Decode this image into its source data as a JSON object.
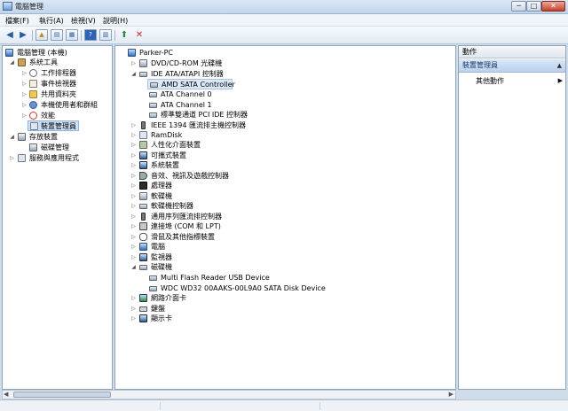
{
  "window": {
    "title": "電腦管理"
  },
  "window_buttons": {
    "minimize": "─",
    "maximize": "□",
    "close": "✕"
  },
  "menu": [
    "檔案(F)",
    "執行(A)",
    "檢視(V)",
    "說明(H)"
  ],
  "toolbar_icons": [
    "back-arrow-icon",
    "forward-arrow-icon",
    "up-folder-icon",
    "show-tree-icon",
    "properties-icon",
    "help-icon",
    "show-action-pane-icon",
    "update-driver-icon",
    "uninstall-icon"
  ],
  "left_tree": {
    "root": "電腦管理 (本機)",
    "items": [
      {
        "label": "系統工具",
        "level": 1,
        "expander": "◢",
        "icon": "tools-icon"
      },
      {
        "label": "工作排程器",
        "level": 2,
        "expander": "▷",
        "icon": "clock-icon"
      },
      {
        "label": "事件檢視器",
        "level": 2,
        "expander": "▷",
        "icon": "event-log-icon"
      },
      {
        "label": "共用資料夾",
        "level": 2,
        "expander": "▷",
        "icon": "folder-icon"
      },
      {
        "label": "本機使用者和群組",
        "level": 2,
        "expander": "▷",
        "icon": "users-icon"
      },
      {
        "label": "效能",
        "level": 2,
        "expander": "▷",
        "icon": "performance-icon"
      },
      {
        "label": "裝置管理員",
        "level": 2,
        "expander": "",
        "icon": "device-manager-icon",
        "selected": true
      },
      {
        "label": "存放裝置",
        "level": 1,
        "expander": "◢",
        "icon": "storage-icon"
      },
      {
        "label": "磁碟管理",
        "level": 2,
        "expander": "",
        "icon": "disk-management-icon"
      },
      {
        "label": "服務與應用程式",
        "level": 1,
        "expander": "▷",
        "icon": "services-icon"
      }
    ]
  },
  "device_tree": {
    "root": "Parker-PC",
    "items": [
      {
        "label": "DVD/CD-ROM 光碟機",
        "level": 1,
        "expander": "▷",
        "icon": "dvd-drive-icon"
      },
      {
        "label": "IDE ATA/ATAPI 控制器",
        "level": 1,
        "expander": "◢",
        "icon": "ide-controller-icon"
      },
      {
        "label": "AMD SATA Controller",
        "level": 2,
        "expander": "",
        "icon": "ide-controller-icon",
        "selected": true
      },
      {
        "label": "ATA Channel 0",
        "level": 2,
        "expander": "",
        "icon": "ide-controller-icon"
      },
      {
        "label": "ATA Channel 1",
        "level": 2,
        "expander": "",
        "icon": "ide-controller-icon"
      },
      {
        "label": "標準雙通道 PCI IDE 控制器",
        "level": 2,
        "expander": "",
        "icon": "ide-controller-icon"
      },
      {
        "label": "IEEE 1394 匯流排主機控制器",
        "level": 1,
        "expander": "▷",
        "icon": "ieee1394-icon"
      },
      {
        "label": "RamDisk",
        "level": 1,
        "expander": "▷",
        "icon": "ramdisk-icon"
      },
      {
        "label": "人性化介面裝置",
        "level": 1,
        "expander": "▷",
        "icon": "hid-icon"
      },
      {
        "label": "可攜式裝置",
        "level": 1,
        "expander": "▷",
        "icon": "portable-device-icon"
      },
      {
        "label": "系統裝置",
        "level": 1,
        "expander": "▷",
        "icon": "system-device-icon"
      },
      {
        "label": "音效、視訊及遊戲控制器",
        "level": 1,
        "expander": "▷",
        "icon": "sound-icon"
      },
      {
        "label": "處理器",
        "level": 1,
        "expander": "▷",
        "icon": "processor-icon"
      },
      {
        "label": "軟碟機",
        "level": 1,
        "expander": "▷",
        "icon": "floppy-drive-icon"
      },
      {
        "label": "軟碟機控制器",
        "level": 1,
        "expander": "▷",
        "icon": "floppy-controller-icon"
      },
      {
        "label": "通用序列匯流排控制器",
        "level": 1,
        "expander": "▷",
        "icon": "usb-icon"
      },
      {
        "label": "連接埠 (COM 和 LPT)",
        "level": 1,
        "expander": "▷",
        "icon": "port-icon"
      },
      {
        "label": "滑鼠及其他指標裝置",
        "level": 1,
        "expander": "▷",
        "icon": "mouse-icon"
      },
      {
        "label": "電腦",
        "level": 1,
        "expander": "▷",
        "icon": "computer-icon"
      },
      {
        "label": "監視器",
        "level": 1,
        "expander": "▷",
        "icon": "monitor-icon"
      },
      {
        "label": "磁碟機",
        "level": 1,
        "expander": "◢",
        "icon": "disk-drive-icon"
      },
      {
        "label": "Multi Flash Reader USB Device",
        "level": 2,
        "expander": "",
        "icon": "disk-drive-icon"
      },
      {
        "label": "WDC WD32 00AAKS-00L9A0 SATA Disk Device",
        "level": 2,
        "expander": "",
        "icon": "disk-drive-icon"
      },
      {
        "label": "網路介面卡",
        "level": 1,
        "expander": "▷",
        "icon": "network-adapter-icon"
      },
      {
        "label": "鍵盤",
        "level": 1,
        "expander": "▷",
        "icon": "keyboard-icon"
      },
      {
        "label": "顯示卡",
        "level": 1,
        "expander": "▷",
        "icon": "display-adapter-icon"
      }
    ]
  },
  "actions": {
    "header": "動作",
    "section": "裝置管理員",
    "section_caret": "▲",
    "items": [
      {
        "label": "其他動作",
        "arrow": "▶"
      }
    ]
  },
  "scrollbar": {
    "left": "◀",
    "right": "▶"
  }
}
